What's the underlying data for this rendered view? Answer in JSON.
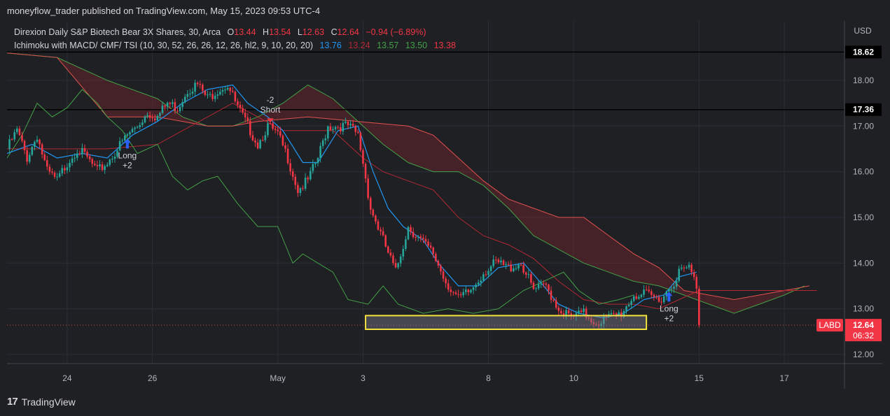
{
  "header": {
    "text": "moneyflow_trader published on TradingView.com, May 15, 2023 09:53 UTC-4"
  },
  "legend": {
    "symbol_line": "Direxion Daily S&P Biotech Bear 3X Shares, 30, Arca",
    "o_label": "O",
    "o": "13.44",
    "h_label": "H",
    "h": "13.54",
    "l_label": "L",
    "l": "12.63",
    "c_label": "C",
    "c": "12.64",
    "change": "−0.94 (−6.89%)",
    "indicator_line": "Ichimoku with MACD/ CMF/ TSI  (10, 30, 52, 26, 26, 12, 26, hl2, 9, 10, 20, 20)",
    "indicator_values": [
      {
        "text": "13.76",
        "color": "#2196f3"
      },
      {
        "text": "13.24",
        "color": "#b22833"
      },
      {
        "text": "13.57",
        "color": "#43a047"
      },
      {
        "text": "13.50",
        "color": "#43a047"
      },
      {
        "text": "13.38",
        "color": "#f23645"
      }
    ]
  },
  "currency": "USD",
  "ticker_badge": {
    "symbol": "LABD",
    "price": "12.64",
    "countdown": "06:32"
  },
  "horizontal_levels": [
    {
      "label": "18.62",
      "value": 18.62
    },
    {
      "label": "17.36",
      "value": 17.36
    }
  ],
  "signals": [
    {
      "text1": "Long",
      "text2": "+2",
      "t": 48,
      "price": 16.6,
      "direction": "up"
    },
    {
      "text1": "-2",
      "text2": "Short",
      "t": 105,
      "price": 17.2,
      "direction": "down"
    },
    {
      "text1": "Long",
      "text2": "+2",
      "t": 264,
      "price": 13.25,
      "direction": "up"
    }
  ],
  "chart_data": {
    "type": "candlestick",
    "ylim": [
      11.8,
      19.3
    ],
    "y_ticks": [
      12.0,
      13.0,
      14.0,
      15.0,
      16.0,
      17.0,
      18.0
    ],
    "x_ticks": [
      {
        "label": "24",
        "t": 24
      },
      {
        "label": "26",
        "t": 58
      },
      {
        "label": "May",
        "t": 108
      },
      {
        "label": "3",
        "t": 142
      },
      {
        "label": "8",
        "t": 192
      },
      {
        "label": "10",
        "t": 226
      },
      {
        "label": "15",
        "t": 276
      },
      {
        "label": "17",
        "t": 310
      }
    ],
    "t_range": [
      0,
      334
    ],
    "last_index": 276,
    "price_path": [
      [
        0,
        16.5
      ],
      [
        4,
        16.9
      ],
      [
        8,
        16.3
      ],
      [
        12,
        16.8
      ],
      [
        16,
        16.0
      ],
      [
        20,
        15.8
      ],
      [
        24,
        16.2
      ],
      [
        28,
        16.5
      ],
      [
        32,
        16.3
      ],
      [
        36,
        16.0
      ],
      [
        40,
        16.2
      ],
      [
        44,
        16.5
      ],
      [
        48,
        16.8
      ],
      [
        52,
        17.0
      ],
      [
        56,
        17.3
      ],
      [
        60,
        17.2
      ],
      [
        64,
        17.5
      ],
      [
        68,
        17.4
      ],
      [
        72,
        17.8
      ],
      [
        76,
        17.9
      ],
      [
        80,
        17.6
      ],
      [
        84,
        17.8
      ],
      [
        88,
        17.9
      ],
      [
        92,
        17.4
      ],
      [
        96,
        17.0
      ],
      [
        100,
        16.6
      ],
      [
        104,
        17.0
      ],
      [
        108,
        16.8
      ],
      [
        112,
        16.3
      ],
      [
        116,
        15.6
      ],
      [
        120,
        15.8
      ],
      [
        124,
        16.3
      ],
      [
        128,
        17.0
      ],
      [
        132,
        17.0
      ],
      [
        136,
        17.0
      ],
      [
        140,
        16.8
      ],
      [
        142,
        16.2
      ],
      [
        145,
        15.2
      ],
      [
        150,
        14.5
      ],
      [
        155,
        13.8
      ],
      [
        160,
        14.8
      ],
      [
        165,
        14.5
      ],
      [
        170,
        14.2
      ],
      [
        175,
        13.6
      ],
      [
        180,
        13.2
      ],
      [
        185,
        13.4
      ],
      [
        190,
        13.8
      ],
      [
        195,
        14.0
      ],
      [
        200,
        13.9
      ],
      [
        205,
        14.0
      ],
      [
        210,
        13.4
      ],
      [
        215,
        13.5
      ],
      [
        220,
        13.0
      ],
      [
        225,
        12.8
      ],
      [
        230,
        12.9
      ],
      [
        235,
        12.7
      ],
      [
        240,
        12.8
      ],
      [
        245,
        12.9
      ],
      [
        250,
        13.3
      ],
      [
        255,
        13.3
      ],
      [
        260,
        13.2
      ],
      [
        265,
        13.5
      ],
      [
        268,
        13.8
      ],
      [
        272,
        13.9
      ],
      [
        275,
        13.5
      ],
      [
        276,
        12.64
      ]
    ],
    "tenkan": [
      [
        0,
        16.4
      ],
      [
        10,
        16.6
      ],
      [
        20,
        16.3
      ],
      [
        30,
        16.4
      ],
      [
        40,
        16.3
      ],
      [
        50,
        16.8
      ],
      [
        60,
        17.1
      ],
      [
        70,
        17.5
      ],
      [
        80,
        17.8
      ],
      [
        90,
        17.9
      ],
      [
        96,
        17.5
      ],
      [
        104,
        17.2
      ],
      [
        110,
        16.9
      ],
      [
        118,
        16.2
      ],
      [
        124,
        16.2
      ],
      [
        132,
        16.9
      ],
      [
        140,
        17.0
      ],
      [
        146,
        16.0
      ],
      [
        152,
        15.2
      ],
      [
        158,
        14.8
      ],
      [
        166,
        14.5
      ],
      [
        172,
        14.0
      ],
      [
        180,
        13.5
      ],
      [
        188,
        13.5
      ],
      [
        196,
        13.9
      ],
      [
        206,
        14.0
      ],
      [
        214,
        13.5
      ],
      [
        220,
        13.1
      ],
      [
        228,
        12.9
      ],
      [
        238,
        12.8
      ],
      [
        246,
        12.9
      ],
      [
        254,
        13.2
      ],
      [
        262,
        13.3
      ],
      [
        268,
        13.7
      ],
      [
        275,
        13.8
      ]
    ],
    "kijun": [
      [
        0,
        16.5
      ],
      [
        20,
        16.5
      ],
      [
        40,
        16.5
      ],
      [
        60,
        16.6
      ],
      [
        80,
        17.2
      ],
      [
        90,
        17.5
      ],
      [
        100,
        17.2
      ],
      [
        110,
        16.9
      ],
      [
        120,
        16.9
      ],
      [
        130,
        16.9
      ],
      [
        142,
        16.3
      ],
      [
        150,
        16.0
      ],
      [
        160,
        15.8
      ],
      [
        170,
        15.6
      ],
      [
        180,
        15.0
      ],
      [
        190,
        14.6
      ],
      [
        200,
        14.4
      ],
      [
        210,
        14.1
      ],
      [
        220,
        13.6
      ],
      [
        230,
        13.2
      ],
      [
        240,
        13.1
      ],
      [
        250,
        13.1
      ],
      [
        260,
        13.0
      ],
      [
        268,
        13.2
      ],
      [
        276,
        13.4
      ],
      [
        300,
        13.4
      ],
      [
        323,
        13.4
      ]
    ],
    "span_a": [
      [
        0,
        18.6
      ],
      [
        20,
        18.5
      ],
      [
        40,
        18.0
      ],
      [
        60,
        17.6
      ],
      [
        70,
        17.2
      ],
      [
        80,
        17.0
      ],
      [
        90,
        17.0
      ],
      [
        100,
        17.2
      ],
      [
        110,
        17.5
      ],
      [
        120,
        17.9
      ],
      [
        130,
        17.6
      ],
      [
        140,
        17.1
      ],
      [
        150,
        16.6
      ],
      [
        160,
        16.2
      ],
      [
        170,
        16.0
      ],
      [
        180,
        16.0
      ],
      [
        190,
        15.7
      ],
      [
        200,
        15.2
      ],
      [
        210,
        14.6
      ],
      [
        220,
        14.3
      ],
      [
        230,
        14.0
      ],
      [
        240,
        13.8
      ],
      [
        250,
        13.6
      ],
      [
        260,
        13.5
      ],
      [
        270,
        13.3
      ],
      [
        280,
        13.1
      ],
      [
        290,
        12.9
      ],
      [
        300,
        13.1
      ],
      [
        310,
        13.3
      ],
      [
        318,
        13.5
      ]
    ],
    "span_b": [
      [
        0,
        18.6
      ],
      [
        20,
        18.5
      ],
      [
        40,
        17.2
      ],
      [
        60,
        17.2
      ],
      [
        80,
        17.0
      ],
      [
        90,
        17.0
      ],
      [
        100,
        17.1
      ],
      [
        120,
        17.2
      ],
      [
        140,
        17.1
      ],
      [
        160,
        17.0
      ],
      [
        170,
        16.8
      ],
      [
        180,
        16.3
      ],
      [
        190,
        15.8
      ],
      [
        200,
        15.4
      ],
      [
        210,
        15.2
      ],
      [
        220,
        15.0
      ],
      [
        230,
        15.0
      ],
      [
        240,
        14.6
      ],
      [
        250,
        14.2
      ],
      [
        260,
        13.9
      ],
      [
        270,
        13.4
      ],
      [
        280,
        13.3
      ],
      [
        290,
        13.2
      ],
      [
        300,
        13.3
      ],
      [
        310,
        13.4
      ],
      [
        320,
        13.5
      ]
    ],
    "chikou": [
      [
        0,
        16.3
      ],
      [
        6,
        16.8
      ],
      [
        12,
        17.5
      ],
      [
        18,
        17.2
      ],
      [
        24,
        17.4
      ],
      [
        30,
        17.8
      ],
      [
        36,
        17.5
      ],
      [
        40,
        17.2
      ],
      [
        46,
        16.9
      ],
      [
        52,
        16.4
      ],
      [
        60,
        16.6
      ],
      [
        66,
        15.9
      ],
      [
        72,
        15.6
      ],
      [
        78,
        15.8
      ],
      [
        84,
        15.9
      ],
      [
        92,
        15.3
      ],
      [
        100,
        14.8
      ],
      [
        108,
        14.8
      ],
      [
        114,
        14.0
      ],
      [
        118,
        14.2
      ],
      [
        124,
        14.0
      ],
      [
        130,
        13.8
      ],
      [
        136,
        13.2
      ],
      [
        144,
        13.1
      ],
      [
        150,
        13.5
      ],
      [
        156,
        13.1
      ],
      [
        166,
        12.9
      ],
      [
        176,
        13.0
      ],
      [
        186,
        12.9
      ],
      [
        196,
        13.0
      ],
      [
        206,
        13.4
      ],
      [
        214,
        13.6
      ],
      [
        222,
        13.8
      ],
      [
        228,
        13.4
      ],
      [
        236,
        13.1
      ],
      [
        244,
        13.2
      ],
      [
        250,
        13.3
      ]
    ],
    "zone": {
      "price_from": 12.55,
      "price_to": 12.85,
      "t_from": 143,
      "t_to": 255
    },
    "last_price": 12.64
  }
}
